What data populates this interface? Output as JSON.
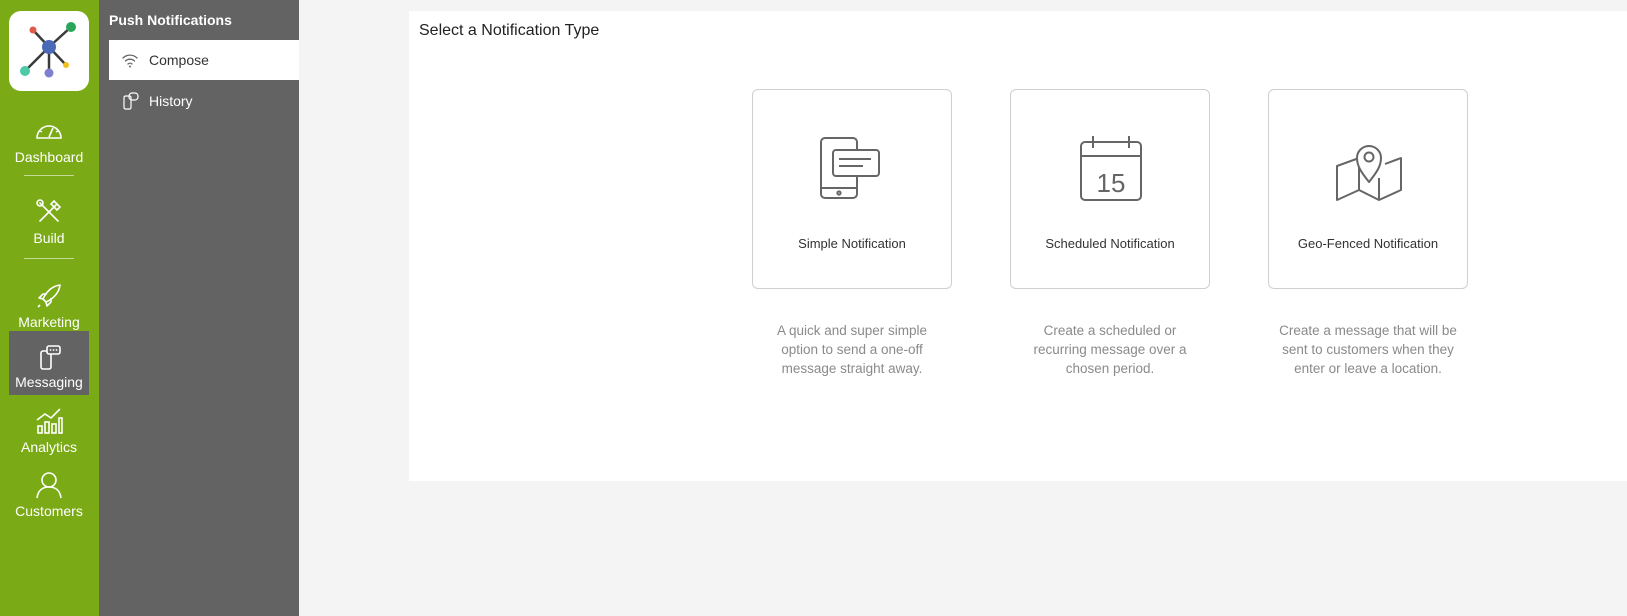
{
  "left_nav": {
    "items": [
      {
        "label": "Dashboard",
        "icon": "gauge-icon"
      },
      {
        "label": "Build",
        "icon": "tools-icon"
      },
      {
        "label": "Marketing",
        "icon": "rocket-icon"
      },
      {
        "label": "Messaging",
        "icon": "phone-chat-icon",
        "active": true
      },
      {
        "label": "Analytics",
        "icon": "chart-icon"
      },
      {
        "label": "Customers",
        "icon": "person-icon"
      }
    ]
  },
  "sub_nav": {
    "title": "Push Notifications",
    "items": [
      {
        "label": "Compose",
        "icon": "wifi-icon",
        "active": true
      },
      {
        "label": "History",
        "icon": "phone-history-icon"
      }
    ]
  },
  "main": {
    "title": "Select a Notification Type",
    "cards": [
      {
        "label": "Simple Notification",
        "icon": "phone-message-icon",
        "description": [
          "A quick and super simple",
          "option to send a one-off",
          "message straight away."
        ]
      },
      {
        "label": "Scheduled Notification",
        "icon": "calendar-icon",
        "calendar_day": "15",
        "description": [
          "Create a scheduled or",
          "recurring message over a",
          "chosen period."
        ]
      },
      {
        "label": "Geo-Fenced Notification",
        "icon": "map-pin-icon",
        "description": [
          "Create a message that will be",
          "sent to customers when they",
          "enter or leave a location."
        ]
      }
    ]
  },
  "colors": {
    "nav_green": "#7aaa16",
    "subnav_gray": "#636363",
    "background": "#f4f4f4"
  }
}
